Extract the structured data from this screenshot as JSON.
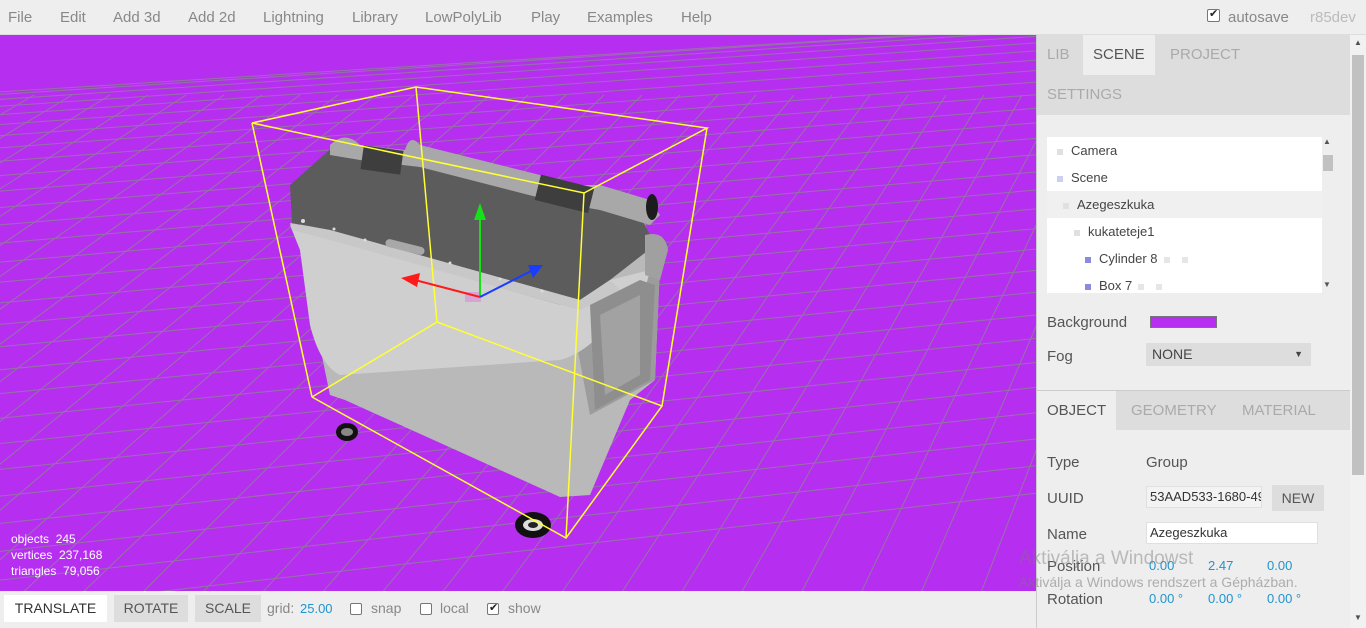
{
  "menubar": {
    "items": [
      "File",
      "Edit",
      "Add 3d",
      "Add 2d",
      "Lightning",
      "Library",
      "LowPolyLib",
      "Play",
      "Examples",
      "Help"
    ],
    "autosave_label": "autosave",
    "autosave_checked": true,
    "version": "r85dev"
  },
  "viewport": {
    "background": "#b62ff1",
    "info": {
      "objects_label": "objects",
      "objects": "245",
      "vertices_label": "vertices",
      "vertices": "237,168",
      "triangles_label": "triangles",
      "triangles": "79,056"
    }
  },
  "toolbar": {
    "translate": "TRANSLATE",
    "rotate": "ROTATE",
    "scale": "SCALE",
    "grid_label": "grid:",
    "grid_value": "25.00",
    "snap_label": "snap",
    "local_label": "local",
    "show_label": "show",
    "snap_checked": false,
    "local_checked": false,
    "show_checked": true
  },
  "sidebar": {
    "top_tabs": [
      "LIB",
      "SCENE",
      "PROJECT",
      "SETTINGS"
    ],
    "active_top_tab": "SCENE",
    "outliner": [
      {
        "label": "Camera",
        "color": "#e0e0e0"
      },
      {
        "label": "Scene",
        "color": "#cccff0"
      },
      {
        "label": "Azegeszkuka",
        "color": "#e0e0e0"
      },
      {
        "label": "kukateteje1",
        "color": "#e0e0e0"
      },
      {
        "label": "Cylinder 8",
        "color": "#8a8ae0"
      },
      {
        "label": "Box 7",
        "color": "#8a8ae0"
      }
    ],
    "background_label": "Background",
    "background_color": "#b62ff1",
    "fog_label": "Fog",
    "fog_value": "NONE",
    "object_tabs": [
      "OBJECT",
      "GEOMETRY",
      "MATERIAL"
    ],
    "active_object_tab": "OBJECT",
    "type_label": "Type",
    "type_value": "Group",
    "uuid_label": "UUID",
    "uuid_value": "53AAD533-1680-49",
    "new_button": "NEW",
    "name_label": "Name",
    "name_value": "Azegeszkuka",
    "position_label": "Position",
    "position": [
      "0.00",
      "2.47",
      "0.00"
    ],
    "rotation_label": "Rotation",
    "rotation": [
      "0.00 °",
      "0.00 °",
      "0.00 °"
    ]
  },
  "watermark": {
    "line1": "Aktiválja a Windowst",
    "line2": "Aktiválja a Windows rendszert a Gépházban."
  }
}
